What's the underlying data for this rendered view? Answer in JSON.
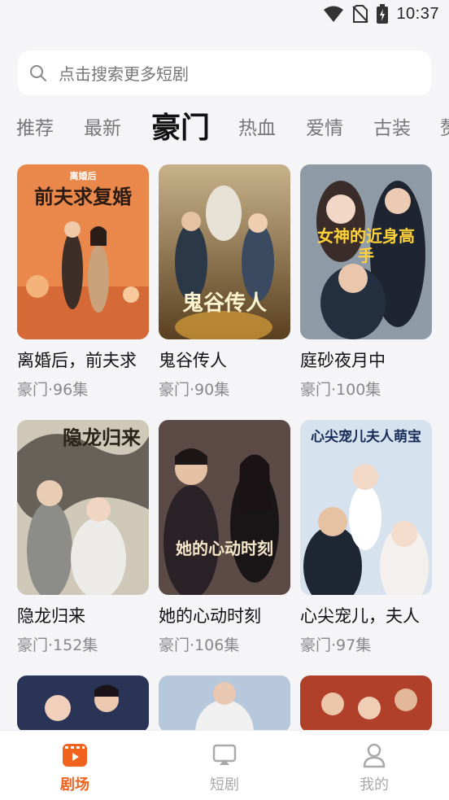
{
  "status": {
    "time": "10:37",
    "icons": [
      "wifi-icon",
      "no-sim-icon",
      "battery-charging-icon"
    ]
  },
  "search": {
    "placeholder": "点击搜索更多短剧"
  },
  "tabs": [
    {
      "label": "推荐",
      "active": false
    },
    {
      "label": "最新",
      "active": false
    },
    {
      "label": "豪门",
      "active": true
    },
    {
      "label": "热血",
      "active": false
    },
    {
      "label": "爱情",
      "active": false
    },
    {
      "label": "古装",
      "active": false
    },
    {
      "label": "赘",
      "active": false
    }
  ],
  "dramas": [
    {
      "title": "离婚后，前夫求",
      "meta": "豪门·96集",
      "poster_text": "前夫求复婚",
      "poster_sub": "离婚后"
    },
    {
      "title": "鬼谷传人",
      "meta": "豪门·90集",
      "poster_text": "鬼谷传人",
      "poster_sub": ""
    },
    {
      "title": "庭砂夜月中",
      "meta": "豪门·100集",
      "poster_text": "女神的近身高手",
      "poster_sub": ""
    },
    {
      "title": "隐龙归来",
      "meta": "豪门·152集",
      "poster_text": "隐龙归来",
      "poster_sub": ""
    },
    {
      "title": "她的心动时刻",
      "meta": "豪门·106集",
      "poster_text": "她的心动时刻",
      "poster_sub": ""
    },
    {
      "title": "心尖宠儿，夫人",
      "meta": "豪门·97集",
      "poster_text": "心尖宠儿夫人萌宝",
      "poster_sub": ""
    }
  ],
  "bottom_nav": [
    {
      "label": "剧场",
      "icon": "theater-icon",
      "active": true
    },
    {
      "label": "短剧",
      "icon": "short-drama-icon",
      "active": false
    },
    {
      "label": "我的",
      "icon": "profile-icon",
      "active": false
    }
  ],
  "colors": {
    "accent": "#f0621e",
    "background": "#f5f5f7"
  }
}
